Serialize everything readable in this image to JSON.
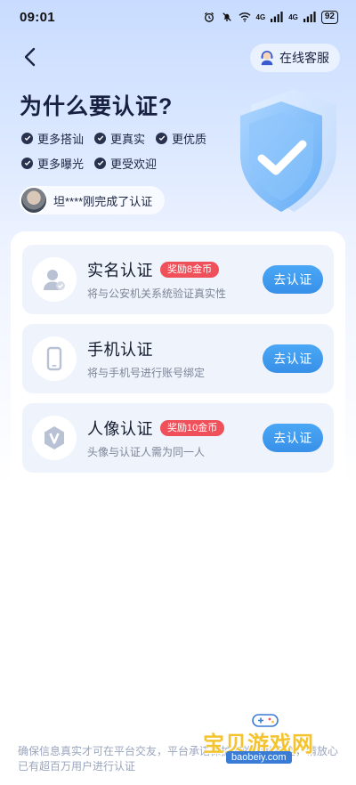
{
  "status_bar": {
    "time": "09:01",
    "network_label": "4G",
    "battery": "92"
  },
  "nav": {
    "service_label": "在线客服"
  },
  "hero": {
    "title": "为什么要认证?",
    "perks": [
      "更多搭讪",
      "更真实",
      "更优质",
      "更多曝光",
      "更受欢迎"
    ],
    "recent_text": "坦****刚完成了认证"
  },
  "certifications": [
    {
      "title": "实名认证",
      "badge": "奖励8金币",
      "description": "将与公安机关系统验证真实性",
      "button": "去认证",
      "icon": "id-card-icon"
    },
    {
      "title": "手机认证",
      "badge": "",
      "description": "将与手机号进行账号绑定",
      "button": "去认证",
      "icon": "phone-icon"
    },
    {
      "title": "人像认证",
      "badge": "奖励10金币",
      "description": "头像与认证人需为同一人",
      "button": "去认证",
      "icon": "vip-shield-icon"
    }
  ],
  "footer": {
    "line1": "确保信息真实才可在平台交友，平台承诺保护您的隐私安全，请放心",
    "line2": "已有超百万用户进行认证"
  },
  "watermark": {
    "name": "宝贝游戏网",
    "url": "baobeiy.com"
  },
  "colors": {
    "accent": "#3f96ec",
    "badge": "#f0505a"
  }
}
